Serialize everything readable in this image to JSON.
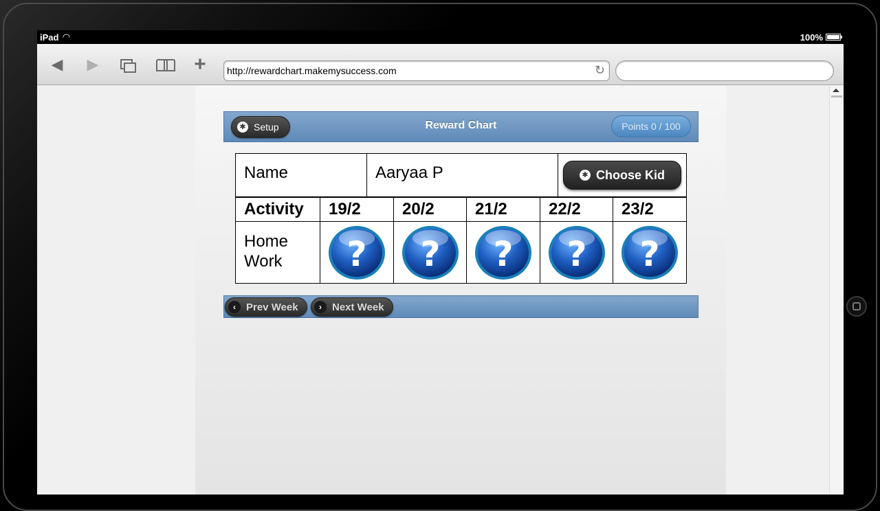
{
  "device": {
    "carrier": "iPad",
    "battery_percent": "100%",
    "battery_level": 1.0
  },
  "browser": {
    "url": "http://rewardchart.makemysuccess.com",
    "search_placeholder": ""
  },
  "header": {
    "title": "Reward Chart",
    "setup_label": "Setup",
    "points_label": "Points 0 / 100"
  },
  "chart": {
    "name_label": "Name",
    "kid_name": "Aaryaa P",
    "choose_kid_label": "Choose Kid",
    "activity_header": "Activity",
    "days": [
      "19/2",
      "20/2",
      "21/2",
      "22/2",
      "23/2"
    ],
    "activities": [
      {
        "name_line1": "Home",
        "name_line2": "Work",
        "status_icons": [
          "question-icon",
          "question-icon",
          "question-icon",
          "question-icon",
          "question-icon"
        ]
      }
    ]
  },
  "footer": {
    "prev_label": "Prev Week",
    "next_label": "Next Week"
  },
  "colors": {
    "bar_blue": "#6f97c3",
    "button_dark": "#333333",
    "icon_blue": "#1f5fc2"
  }
}
